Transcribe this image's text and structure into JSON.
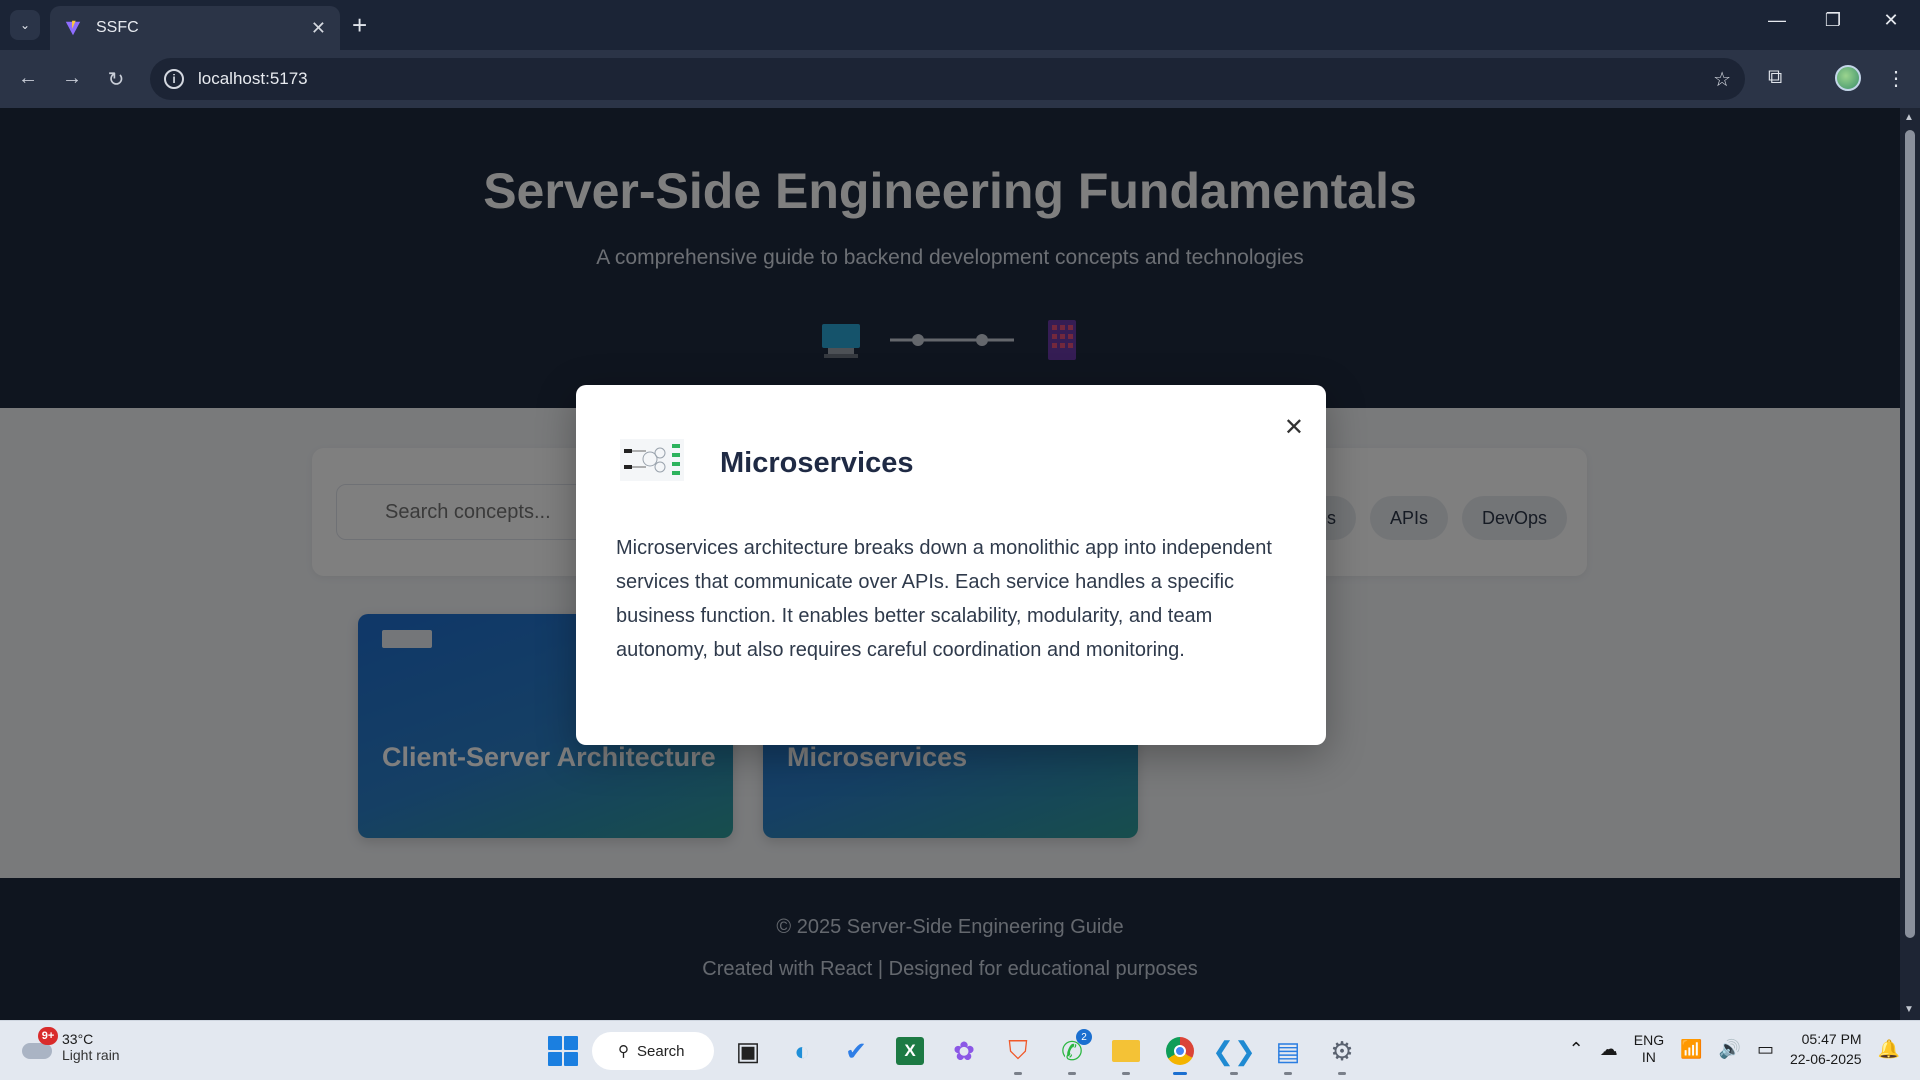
{
  "browser": {
    "tab_title": "SSFC",
    "url": "localhost:5173",
    "tab_close": "✕",
    "new_tab": "+"
  },
  "hero": {
    "title": "Server-Side Engineering Fundamentals",
    "subtitle": "A comprehensive guide to backend development concepts and technologies"
  },
  "search": {
    "placeholder": "Search concepts..."
  },
  "filters": [
    "ses",
    "APIs",
    "DevOps"
  ],
  "cards": [
    {
      "title": "Client-Server Architecture"
    },
    {
      "title": "Microservices"
    }
  ],
  "footer": {
    "line1": "© 2025 Server-Side Engineering Guide",
    "line2": "Created with React | Designed for educational purposes"
  },
  "modal": {
    "title": "Microservices",
    "body": "Microservices architecture breaks down a monolithic app into independent services that communicate over APIs. Each service handles a specific business function. It enables better scalability, modularity, and team autonomy, but also requires careful coordination and monitoring.",
    "close": "✕"
  },
  "taskbar": {
    "weather_temp": "33°C",
    "weather_cond": "Light rain",
    "weather_badge": "9+",
    "search_label": "Search",
    "whatsapp_badge": "2",
    "lang_line1": "ENG",
    "lang_line2": "IN",
    "time": "05:47 PM",
    "date": "22-06-2025"
  }
}
